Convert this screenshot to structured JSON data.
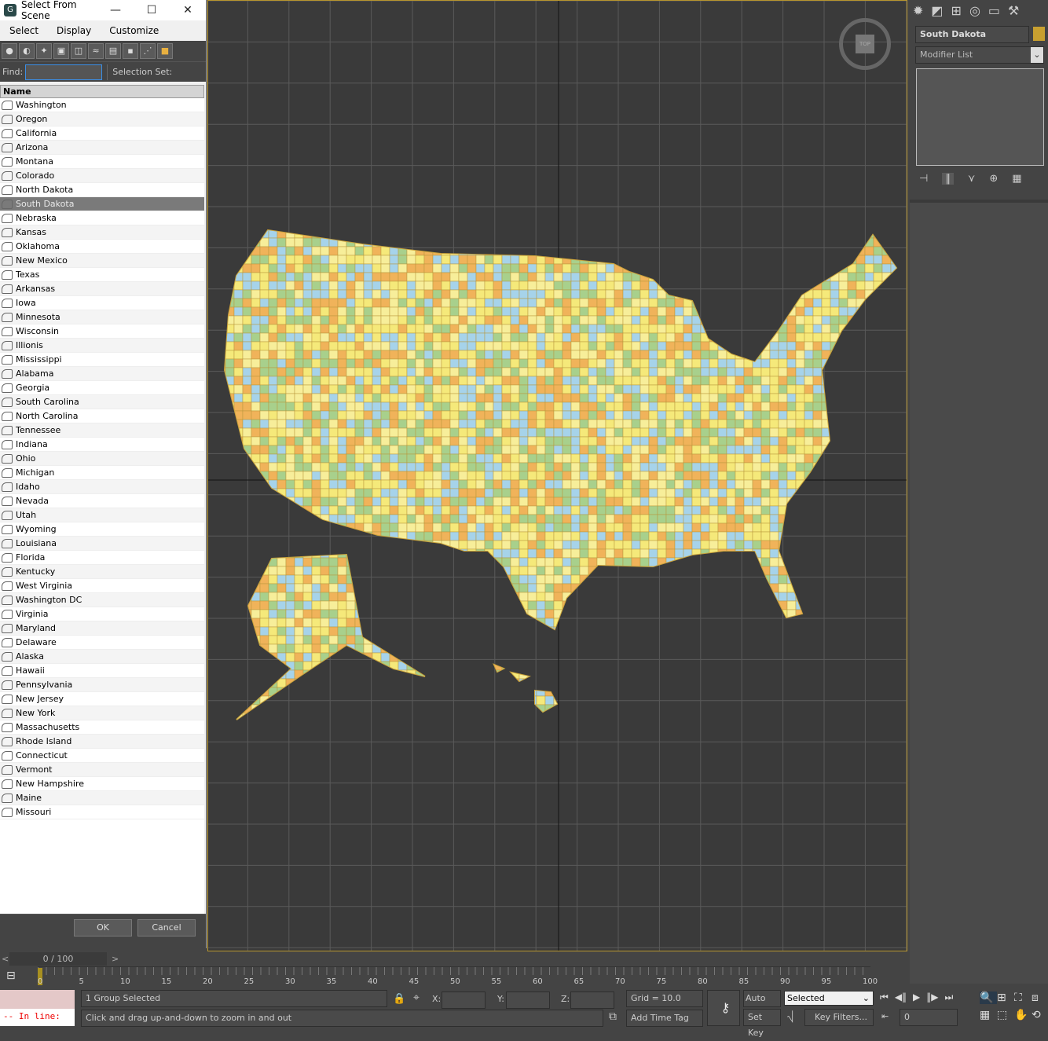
{
  "dialog": {
    "title": "Select From Scene",
    "menu": [
      "Select",
      "Display",
      "Customize"
    ],
    "find_label": "Find:",
    "find_value": "",
    "selection_set_label": "Selection Set:",
    "column_name": "Name",
    "ok": "OK",
    "cancel": "Cancel"
  },
  "objects": [
    "Washington",
    "Oregon",
    "California",
    "Arizona",
    "Montana",
    "Colorado",
    "North Dakota",
    "South Dakota",
    "Nebraska",
    "Kansas",
    "Oklahoma",
    "New Mexico",
    "Texas",
    "Arkansas",
    "Iowa",
    "Minnesota",
    "Wisconsin",
    "Illionis",
    "Mississippi",
    "Alabama",
    "Georgia",
    "South Carolina",
    "North Carolina",
    "Tennessee",
    "Indiana",
    "Ohio",
    "Michigan",
    "Idaho",
    "Nevada",
    "Utah",
    "Wyoming",
    "Louisiana",
    "Florida",
    "Kentucky",
    "West Virginia",
    "Washington DC",
    "Virginia",
    "Maryland",
    "Delaware",
    "Alaska",
    "Hawaii",
    "Pennsylvania",
    "New Jersey",
    "New York",
    "Massachusetts",
    "Rhode Island",
    "Connecticut",
    "Vermont",
    "New Hampshire",
    "Maine",
    "Missouri"
  ],
  "selected_object": "South Dakota",
  "viewport": {
    "viewcube": "TOP",
    "map_colors": [
      "#f5e97a",
      "#f0b35a",
      "#a8d08c",
      "#a6d3ea",
      "#f7ee9a"
    ]
  },
  "right_panel": {
    "object_name": "South Dakota",
    "object_color": "#c8a030",
    "modifier_list": "Modifier List"
  },
  "timeline": {
    "frame": "0 / 100",
    "ticks": [
      "0",
      "5",
      "10",
      "15",
      "20",
      "25",
      "30",
      "35",
      "40",
      "45",
      "50",
      "55",
      "60",
      "65",
      "70",
      "75",
      "80",
      "85",
      "90",
      "95",
      "100"
    ]
  },
  "status": {
    "maxscript": "--  In line:",
    "selection": "1 Group Selected",
    "prompt": "Click and drag up-and-down to zoom in and out",
    "x_label": "X:",
    "y_label": "Y:",
    "z_label": "Z:",
    "grid": "Grid = 10.0",
    "add_time_tag": "Add Time Tag",
    "auto_key": "Auto Key",
    "set_key": "Set Key",
    "key_mode": "Selected",
    "key_filters": "Key Filters...",
    "current_frame": "0"
  }
}
